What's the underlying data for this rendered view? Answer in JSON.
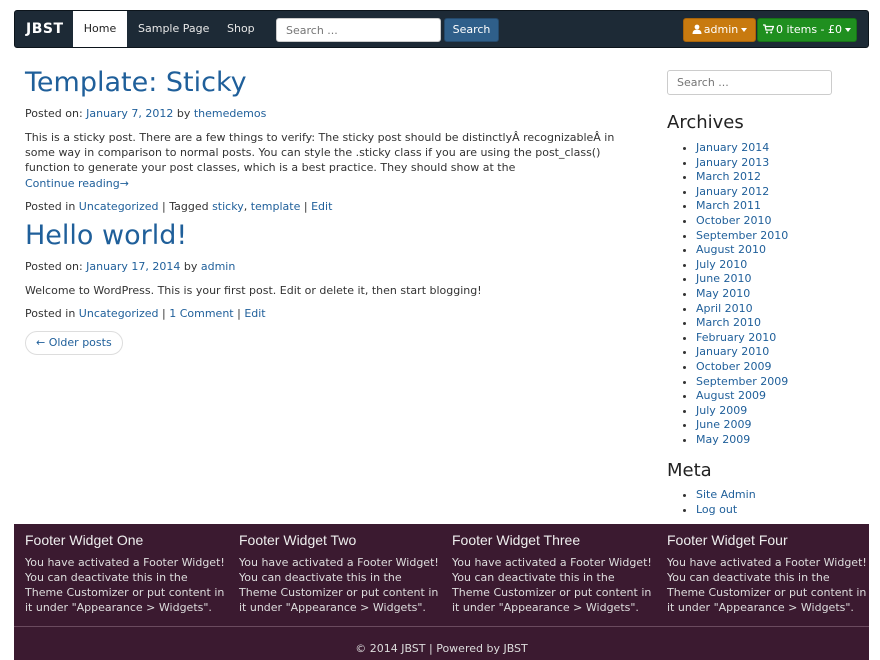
{
  "navbar": {
    "brand": "JBST",
    "items": [
      {
        "label": "Home"
      },
      {
        "label": "Sample Page"
      },
      {
        "label": "Shop"
      }
    ],
    "search_placeholder": "Search ...",
    "search_button": "Search",
    "admin_label": "admin",
    "cart_label": "0 items - £0",
    "colors": {
      "admin": "#c87a0f",
      "cart": "#1f8f1f",
      "search_button": "#2f5f8a"
    }
  },
  "posts": [
    {
      "title": "Template: Sticky",
      "posted_on_prefix": "Posted on: ",
      "date": "January 7, 2012",
      "by": " by ",
      "author": "themedemos",
      "excerpt": "This is a sticky post. There are a few things to verify: The sticky post should be distinctlyÂ recognizableÂ in some way in comparison to normal posts. You can style the .sticky class if you are using the post_class() function to generate your post classes, which is a best practice. They should show at the",
      "continue": "Continue reading→",
      "posted_in": "Posted in ",
      "category": "Uncategorized",
      "tagged": " | Tagged ",
      "tags": [
        "sticky",
        "template"
      ],
      "edit": "Edit"
    },
    {
      "title": "Hello world!",
      "posted_on_prefix": "Posted on: ",
      "date": "January 17, 2014",
      "by": " by ",
      "author": "admin",
      "excerpt": "Welcome to WordPress. This is your first post. Edit or delete it, then start blogging!",
      "posted_in": "Posted in ",
      "category": "Uncategorized",
      "comments": "1 Comment",
      "edit": "Edit"
    }
  ],
  "older_posts": "← Older posts",
  "sidebar": {
    "search_placeholder": "Search ...",
    "archives_title": "Archives",
    "archives": [
      "January 2014",
      "January 2013",
      "March 2012",
      "January 2012",
      "March 2011",
      "October 2010",
      "September 2010",
      "August 2010",
      "July 2010",
      "June 2010",
      "May 2010",
      "April 2010",
      "March 2010",
      "February 2010",
      "January 2010",
      "October 2009",
      "September 2009",
      "August 2009",
      "July 2009",
      "June 2009",
      "May 2009"
    ],
    "meta_title": "Meta",
    "meta_links": [
      "Site Admin",
      "Log out"
    ]
  },
  "footer": {
    "widgets": [
      {
        "title": "Footer Widget One",
        "text": "You have activated a Footer Widget! You can deactivate this in the Theme Customizer or put content in it under \"Appearance > Widgets\"."
      },
      {
        "title": "Footer Widget Two",
        "text": "You have activated a Footer Widget! You can deactivate this in the Theme Customizer or put content in it under \"Appearance > Widgets\"."
      },
      {
        "title": "Footer Widget Three",
        "text": "You have activated a Footer Widget! You can deactivate this in the Theme Customizer or put content in it under \"Appearance > Widgets\"."
      },
      {
        "title": "Footer Widget Four",
        "text": "You have activated a Footer Widget! You can deactivate this in the Theme Customizer or put content in it under \"Appearance > Widgets\"."
      }
    ],
    "copyright": "© 2014 JBST | Powered by JBST",
    "background": "#3b1a30"
  }
}
